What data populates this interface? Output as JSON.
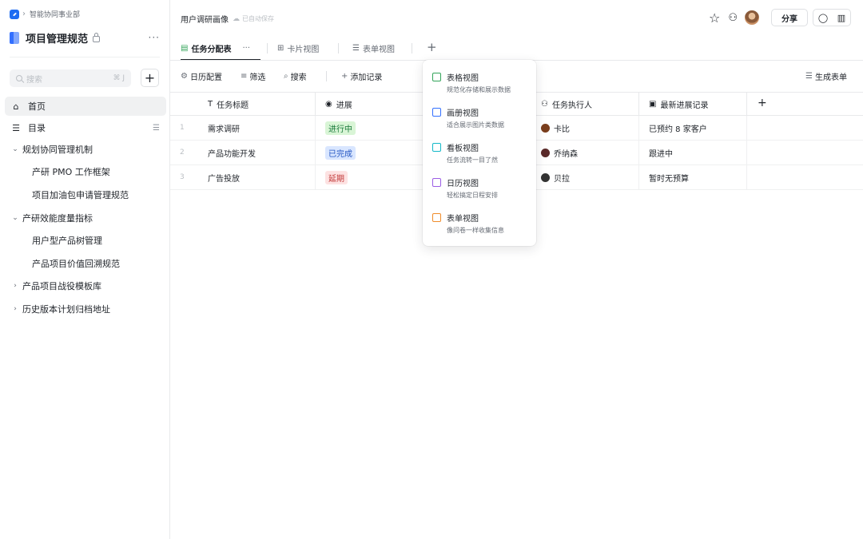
{
  "sidebar": {
    "breadcrumb": "智能协同事业部",
    "space_title": "项目管理规范",
    "more": "···",
    "search_placeholder": "搜索",
    "search_shortcut": "⌘ J",
    "nav": [
      {
        "label": "首页"
      },
      {
        "label": "目录"
      }
    ],
    "tree": [
      {
        "label": "规划协同管理机制",
        "level": 0,
        "chev": "⌄"
      },
      {
        "label": "产研 PMO 工作框架",
        "level": 1
      },
      {
        "label": "项目加油包申请管理规范",
        "level": 1
      },
      {
        "label": "产研效能度量指标",
        "level": 0,
        "chev": "⌄"
      },
      {
        "label": "用户型产品树管理",
        "level": 1
      },
      {
        "label": "产品项目价值回溯规范",
        "level": 1
      },
      {
        "label": "产品项目战役模板库",
        "level": 0,
        "chev": "›"
      },
      {
        "label": "历史版本计划归档地址",
        "level": 0,
        "chev": "›"
      }
    ]
  },
  "header": {
    "doc_title": "用户调研画像",
    "saved_status": "已自动保存",
    "share_label": "分享"
  },
  "tabs": [
    {
      "label": "任务分配表",
      "icon": "▤"
    },
    {
      "label": "卡片视图",
      "icon": "⊞"
    },
    {
      "label": "表单视图",
      "icon": "☰"
    }
  ],
  "tab_more": "···",
  "toolbar": {
    "calendar_config": "日历配置",
    "filter": "筛选",
    "search": "搜索",
    "add_record": "添加记录",
    "generate_form": "生成表单"
  },
  "table": {
    "columns": [
      "任务标题",
      "进展",
      "任务执行人",
      "最新进展记录"
    ],
    "rows": [
      {
        "num": "1",
        "title": "需求调研",
        "status": "进行中",
        "status_color": "green",
        "assignee": "卡比",
        "record": "已预约 8 家客户"
      },
      {
        "num": "2",
        "title": "产品功能开发",
        "status": "已完成",
        "status_color": "blue",
        "assignee": "乔纳森",
        "record": "跟进中"
      },
      {
        "num": "3",
        "title": "广告投放",
        "status": "延期",
        "status_color": "red",
        "assignee": "贝拉",
        "record": "暂时无预算"
      }
    ]
  },
  "dropdown": {
    "items": [
      {
        "title": "表格视图",
        "desc": "规范化存储和展示数据",
        "color": "#33a45a"
      },
      {
        "title": "画册视图",
        "desc": "适合展示图片类数据",
        "color": "#3370ff"
      },
      {
        "title": "看板视图",
        "desc": "任务流转一目了然",
        "color": "#14b8c8"
      },
      {
        "title": "日历视图",
        "desc": "轻松搞定日程安排",
        "color": "#9b5de5"
      },
      {
        "title": "表单视图",
        "desc": "像问卷一样收集信息",
        "color": "#f08c2a"
      }
    ]
  }
}
